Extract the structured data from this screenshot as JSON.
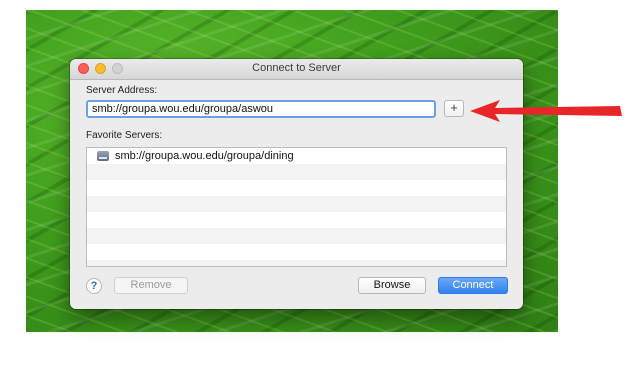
{
  "window": {
    "title": "Connect to Server"
  },
  "server_address": {
    "label": "Server Address:",
    "value": "smb://groupa.wou.edu/groupa/aswou",
    "add_button": "+"
  },
  "favorites": {
    "label": "Favorite Servers:",
    "items": [
      {
        "label": "smb://groupa.wou.edu/groupa/dining"
      }
    ]
  },
  "buttons": {
    "help": "?",
    "remove": "Remove",
    "browse": "Browse",
    "connect": "Connect"
  },
  "colors": {
    "arrow": "#e8262a",
    "connect": "#2f82ee",
    "focus_ring": "#6aa0e6"
  }
}
